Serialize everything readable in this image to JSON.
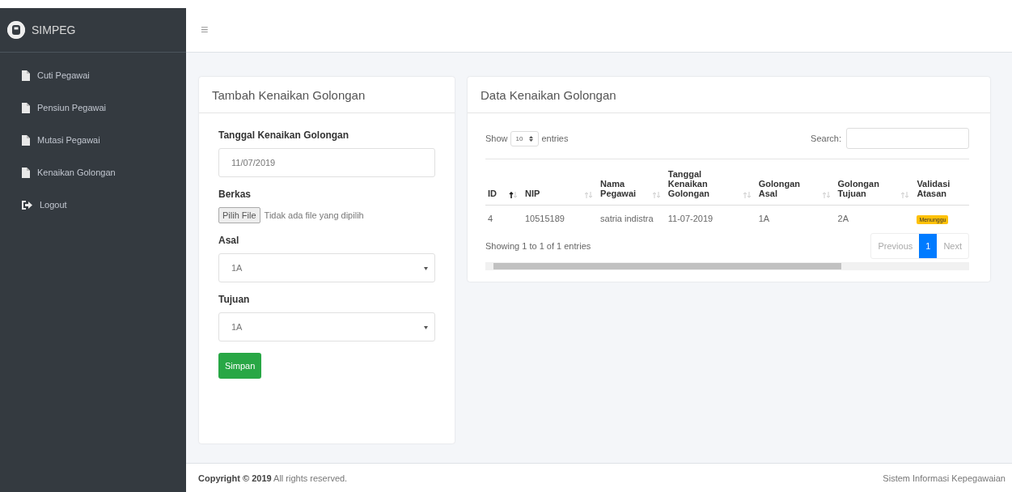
{
  "brand": {
    "title": "SIMPEG"
  },
  "sidebar": {
    "items": [
      {
        "label": "Cuti Pegawai",
        "kind": "file"
      },
      {
        "label": "Pensiun Pegawai",
        "kind": "file"
      },
      {
        "label": "Mutasi Pegawai",
        "kind": "file"
      },
      {
        "label": "Kenaikan Golongan",
        "kind": "file"
      },
      {
        "label": "Logout",
        "kind": "logout"
      }
    ]
  },
  "topbar": {
    "menu": "≡"
  },
  "form_card": {
    "title": "Tambah Kenaikan Golongan",
    "fields": [
      {
        "kind": "text",
        "label": "Tanggal Kenaikan Golongan",
        "value": "11/07/2019"
      },
      {
        "kind": "file",
        "label": "Berkas",
        "button": "Pilih File",
        "status": "Tidak ada file yang dipilih"
      },
      {
        "kind": "select",
        "label": "Asal",
        "value": "1A"
      },
      {
        "kind": "select",
        "label": "Tujuan",
        "value": "1A"
      }
    ],
    "submit": "Simpan"
  },
  "table_card": {
    "title": "Data Kenaikan Golongan",
    "length": {
      "before": "Show",
      "value": "10",
      "after": "entries"
    },
    "search": {
      "label": "Search:"
    },
    "columns": [
      {
        "label": "ID",
        "sorted": true
      },
      {
        "label": "NIP",
        "sorted": false
      },
      {
        "label": "Nama Pegawai",
        "sorted": false
      },
      {
        "label": "Tanggal Kenaikan Golongan",
        "sorted": false
      },
      {
        "label": "Golongan Asal",
        "sorted": false
      },
      {
        "label": "Golongan Tujuan",
        "sorted": false
      },
      {
        "label": "Validasi Atasan"
      }
    ],
    "rows": [
      {
        "cells": [
          "4",
          "10515189",
          "satria indistra",
          "11-07-2019",
          "1A",
          "2A"
        ],
        "status": "Menunggu"
      }
    ],
    "info": "Showing 1 to 1 of 1 entries",
    "pagination": [
      {
        "label": "Previous",
        "selected": false
      },
      {
        "label": "1",
        "selected": true
      },
      {
        "label": "Next",
        "selected": false
      }
    ]
  },
  "footer": {
    "copyright": "**Copyright © 2019** All rights reserved.",
    "right": "Sistem Informasi Kepegawaian"
  }
}
